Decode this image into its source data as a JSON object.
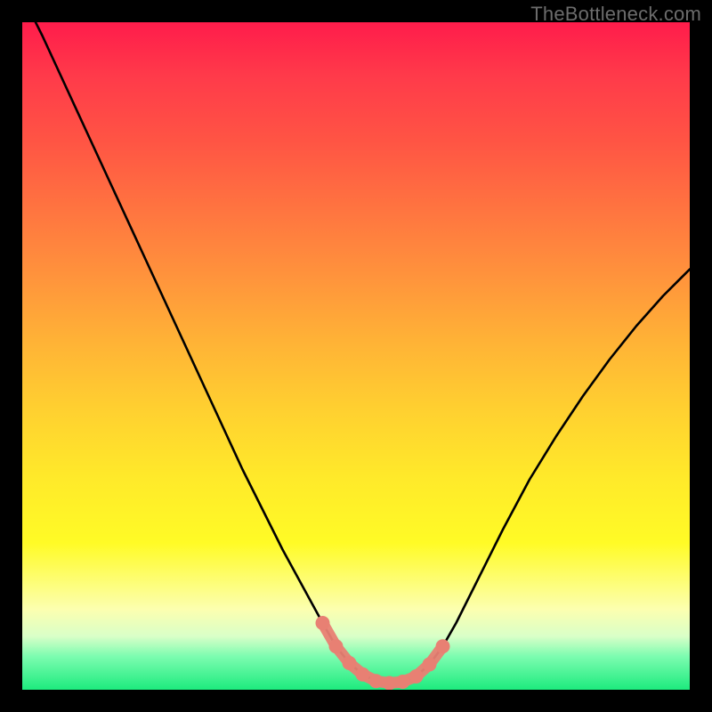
{
  "watermark": "TheBottleneck.com",
  "chart_data": {
    "type": "line",
    "title": "",
    "xlabel": "",
    "ylabel": "",
    "xlim": [
      0,
      100
    ],
    "ylim": [
      0,
      100
    ],
    "series": [
      {
        "name": "bottleneck-curve",
        "x": [
          0,
          3,
          6,
          9,
          12,
          15,
          18,
          21,
          24,
          27,
          30,
          33,
          36,
          39,
          42,
          45,
          47,
          49,
          51,
          53,
          55,
          57,
          59,
          61,
          63,
          65,
          68,
          72,
          76,
          80,
          84,
          88,
          92,
          96,
          100
        ],
        "y": [
          104,
          98,
          91.5,
          85,
          78.5,
          72,
          65.5,
          59,
          52.5,
          46,
          39.5,
          33,
          27,
          21,
          15.5,
          10,
          6.5,
          4,
          2.3,
          1.3,
          1,
          1.2,
          2,
          3.8,
          6.5,
          10,
          16,
          24,
          31.5,
          38,
          44,
          49.5,
          54.5,
          59,
          63
        ]
      }
    ],
    "markers": {
      "name": "highlight-points",
      "x": [
        45,
        47,
        49,
        51,
        53,
        55,
        57,
        59,
        61,
        63
      ],
      "y": [
        10,
        6.5,
        4,
        2.3,
        1.3,
        1,
        1.2,
        2,
        3.8,
        6.5
      ]
    }
  }
}
